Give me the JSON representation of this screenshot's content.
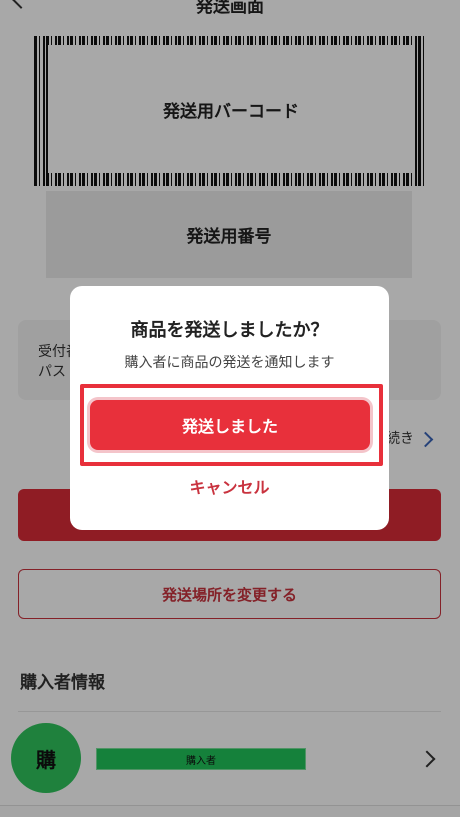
{
  "header": {
    "title": "発送画面"
  },
  "barcode": {
    "label": "発送用バーコード"
  },
  "number": {
    "label": "発送用番号"
  },
  "info": {
    "line1": "受付番号",
    "line2": "パス"
  },
  "procedure": {
    "link_text": "続き"
  },
  "change_location": {
    "label": "発送場所を変更する"
  },
  "buyer_section": {
    "title": "購入者情報",
    "avatar_text": "購",
    "tag": "購入者"
  },
  "dialog": {
    "title": "商品を発送しましたか？",
    "description": "購入者に商品の発送を通知します",
    "confirm_label": "発送しました",
    "cancel_label": "キャンセル"
  },
  "colors": {
    "accent": "#e8303b",
    "avatar": "#2fc45d"
  },
  "icons": {
    "back": "chevron-left-icon",
    "forward": "chevron-right-icon"
  }
}
